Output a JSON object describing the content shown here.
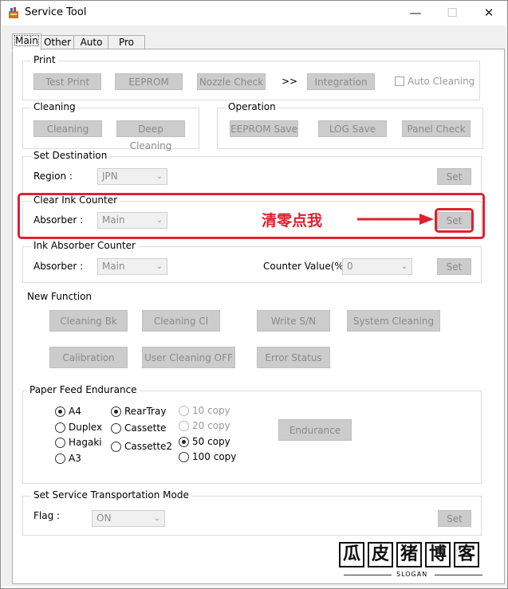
{
  "window": {
    "title": "Service Tool",
    "minimize": "—",
    "maximize": "☐",
    "close": "✕"
  },
  "tabs": [
    "Main",
    "Other",
    "Auto",
    "Pro"
  ],
  "print": {
    "label": "Print",
    "test_print": "Test Print",
    "eeprom": "EEPROM",
    "nozzle_check": "Nozzle Check",
    "arrows": ">>",
    "integration": "Integration",
    "auto_cleaning": "Auto Cleaning"
  },
  "cleaning": {
    "label": "Cleaning",
    "cleaning": "Cleaning",
    "deep_cleaning": "Deep Cleaning"
  },
  "operation": {
    "label": "Operation",
    "eeprom_save": "EEPROM Save",
    "log_save": "LOG Save",
    "panel_check": "Panel Check"
  },
  "destination": {
    "label": "Set Destination",
    "region_label": "Region :",
    "region_value": "JPN",
    "set": "Set"
  },
  "clear_ink": {
    "label": "Clear Ink Counter",
    "absorber_label": "Absorber :",
    "absorber_value": "Main",
    "set": "Set",
    "annotation": "清零点我"
  },
  "ink_absorber": {
    "label": "Ink Absorber Counter",
    "absorber_label": "Absorber :",
    "absorber_value": "Main",
    "counter_label": "Counter Value(%) :",
    "counter_value": "0",
    "set": "Set"
  },
  "new_function": {
    "label": "New Function",
    "buttons": [
      "Cleaning Bk",
      "Cleaning Cl",
      "Write S/N",
      "System Cleaning",
      "Calibration",
      "User Cleaning OFF",
      "Error Status"
    ]
  },
  "paper_feed": {
    "label": "Paper Feed Endurance",
    "sizes": [
      "A4",
      "Duplex",
      "Hagaki",
      "A3"
    ],
    "trays": [
      "RearTray",
      "Cassette",
      "Cassette2"
    ],
    "copies": [
      "10 copy",
      "20 copy",
      "50 copy",
      "100 copy"
    ],
    "endurance": "Endurance",
    "selected_size": "A4",
    "selected_tray": "RearTray",
    "selected_copies": "50 copy"
  },
  "transport": {
    "label": "Set Service Transportation Mode",
    "flag_label": "Flag :",
    "flag_value": "ON",
    "set": "Set"
  },
  "watermark": {
    "chars": [
      "瓜",
      "皮",
      "猪",
      "博",
      "客"
    ],
    "slogan": "SLOGAN"
  },
  "colors": {
    "accent_red": "#e0202e",
    "button_disabled": "#cccccc"
  }
}
